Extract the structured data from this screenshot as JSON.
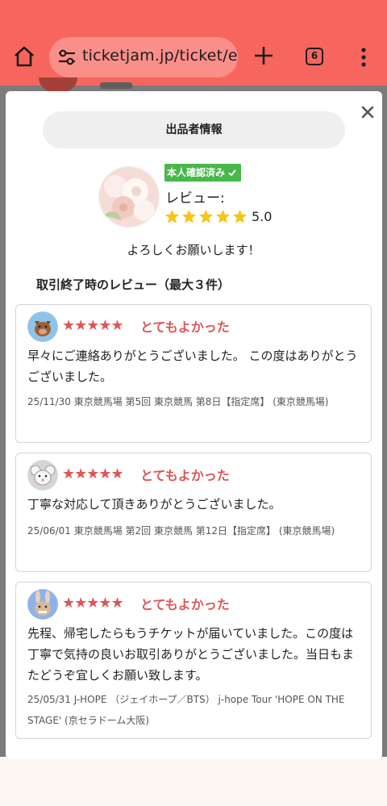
{
  "browser": {
    "url": "ticketjam.jp/ticket/ev",
    "tab_count": "6",
    "icons": [
      "home-icon",
      "tune-icon",
      "new-tab-icon",
      "tab-switcher-icon",
      "menu-icon"
    ]
  },
  "modal": {
    "header_label": "出品者情報",
    "seller": {
      "verified_badge": "本人確認済み",
      "review_label": "レビュー:",
      "rating": "5.0",
      "rating_stars": 5,
      "greeting": "よろしくお願いします！"
    },
    "reviews_title": "取引終了時のレビュー（最大３件）",
    "reviews": [
      {
        "stars": "★★★★★",
        "title": "とてもよかった",
        "avatar": "boar-icon",
        "body": "早々にご連絡ありがとうございました。 この度はありがとうございました。",
        "meta": "25/11/30 東京競馬場 第5回 東京競馬 第8日【指定席】 (東京競馬場)"
      },
      {
        "stars": "★★★★★",
        "title": "とてもよかった",
        "avatar": "mouse-icon",
        "body": "丁寧な対応して頂きありがとうございました。",
        "meta": "25/06/01 東京競馬場 第2回 東京競馬 第12日【指定席】 (東京競馬場)"
      },
      {
        "stars": "★★★★★",
        "title": "とてもよかった",
        "avatar": "rabbit-icon",
        "body": "先程、帰宅したらもうチケットが届いていました。この度は丁寧で気持の良いお取引ありがとうございました。当日もまたどうぞ宜しくお願い致します。",
        "meta": "25/05/31 J-HOPE （ジェイホープ／BTS） j-hope Tour 'HOPE ON THE STAGE' (京セラドーム大阪)"
      }
    ]
  },
  "colors": {
    "browser_bar": "#f7665e",
    "star_gold": "#f5c518",
    "review_red": "#e05555",
    "verified_green": "#47b84a"
  }
}
